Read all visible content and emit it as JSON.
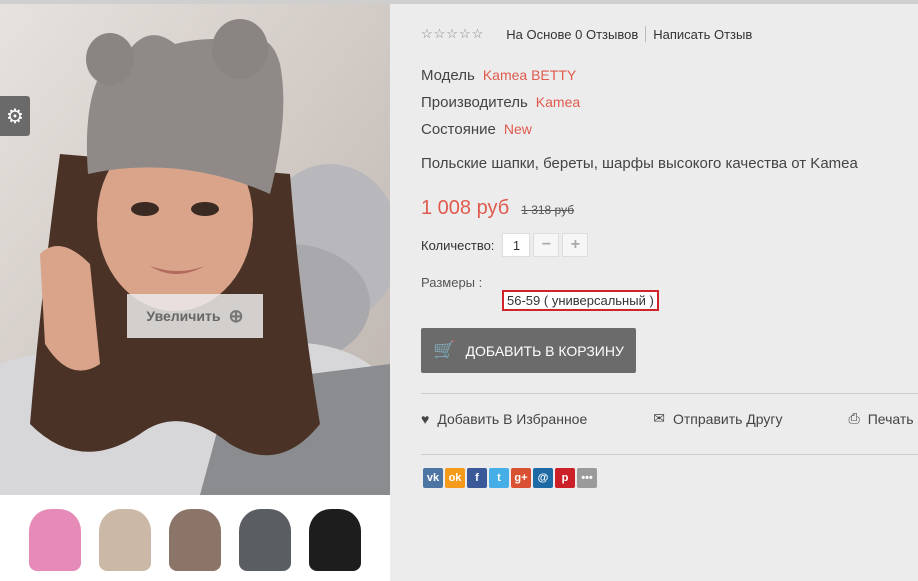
{
  "gallery": {
    "zoom_label": "Увеличить",
    "thumbnails": [
      {
        "name": "pink-hat",
        "color": "#e68ab8"
      },
      {
        "name": "beige-hat",
        "color": "#cbb8a7"
      },
      {
        "name": "brown-hat",
        "color": "#8b7468"
      },
      {
        "name": "gray-hat",
        "color": "#5a5d61"
      },
      {
        "name": "black-hat",
        "color": "#1d1d1d"
      }
    ]
  },
  "rating": {
    "stars": "☆☆☆☆☆",
    "reviews_label": "На Основе 0 Отзывов",
    "write_label": "Написать Отзыв"
  },
  "meta": {
    "model_label": "Модель",
    "model_value": "Kamea BETTY",
    "maker_label": "Производитель",
    "maker_value": "Kamea",
    "state_label": "Состояние",
    "state_value": "New"
  },
  "description": "Польские шапки, береты, шарфы высокого качества от Kamea",
  "price": {
    "current": "1 008 руб",
    "old": "1 318 руб"
  },
  "quantity": {
    "label": "Количество:",
    "value": "1",
    "minus": "−",
    "plus": "+"
  },
  "sizes": {
    "label": "Размеры :",
    "option_prefix": "56-59 ( ",
    "option_main": "универсальный",
    "option_suffix": " )"
  },
  "cart_button": "ДОБАВИТЬ В КОРЗИНУ",
  "actions": {
    "wishlist": "Добавить В Избранное",
    "send_friend": "Отправить Другу",
    "print": "Печать"
  },
  "share": [
    {
      "name": "vk",
      "glyph": "vk",
      "color": "#4c75a3"
    },
    {
      "name": "odnoklassniki",
      "glyph": "ok",
      "color": "#f59a1b"
    },
    {
      "name": "facebook",
      "glyph": "f",
      "color": "#3b5998"
    },
    {
      "name": "twitter",
      "glyph": "t",
      "color": "#45aee6"
    },
    {
      "name": "google-plus",
      "glyph": "g+",
      "color": "#d95033"
    },
    {
      "name": "email",
      "glyph": "@",
      "color": "#1d6aa5"
    },
    {
      "name": "pinterest",
      "glyph": "p",
      "color": "#cb2027"
    },
    {
      "name": "more",
      "glyph": "•••",
      "color": "#9a9a9a"
    }
  ]
}
